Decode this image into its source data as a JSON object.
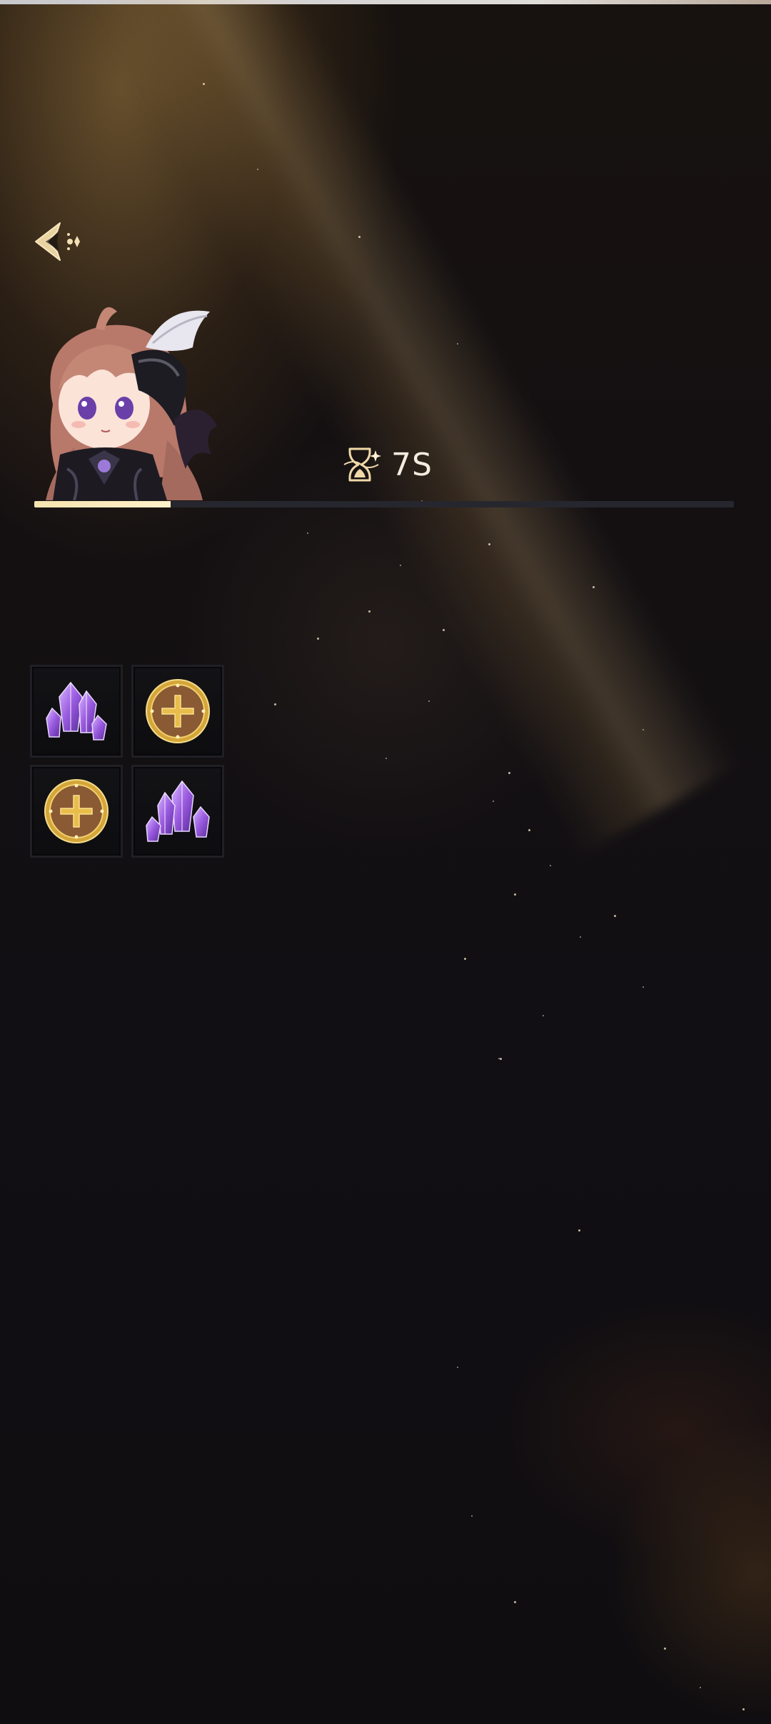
{
  "timer": {
    "icon": "hourglass-icon",
    "text": "7S"
  },
  "progress": {
    "fraction": 0.195,
    "color": "#f6e3b0"
  },
  "back_button": {
    "icon": "back-arrow-icon",
    "color": "#e9d3a1"
  },
  "avatar": {
    "icon": "character-portrait"
  },
  "rewards": [
    {
      "icon": "purple-crystal-icon"
    },
    {
      "icon": "gold-shield-coin-icon"
    },
    {
      "icon": "gold-shield-coin-icon"
    },
    {
      "icon": "purple-crystal-icon"
    }
  ],
  "colors": {
    "background": "#110f13",
    "ray": "#d6a454",
    "text": "#f3ecdf"
  }
}
